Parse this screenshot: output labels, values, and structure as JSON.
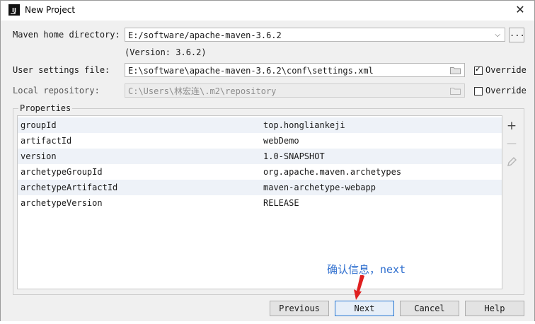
{
  "window": {
    "title": "New Project",
    "app_icon": "IJ"
  },
  "form": {
    "maven_home": {
      "label": "Maven home directory:",
      "value": "E:/software/apache-maven-3.6.2",
      "browse_label": "..."
    },
    "version_hint": "(Version: 3.6.2)",
    "user_settings": {
      "label": "User settings file:",
      "value": "E:\\software\\apache-maven-3.6.2\\conf\\settings.xml",
      "override_label": "Override",
      "override_checked": true
    },
    "local_repo": {
      "label": "Local repository:",
      "value": "C:\\Users\\林宏连\\.m2\\repository",
      "override_label": "Override",
      "override_checked": false
    }
  },
  "properties": {
    "title": "Properties",
    "rows": [
      {
        "key": "groupId",
        "value": "top.hongliankeji"
      },
      {
        "key": "artifactId",
        "value": "webDemo"
      },
      {
        "key": "version",
        "value": "1.0-SNAPSHOT"
      },
      {
        "key": "archetypeGroupId",
        "value": "org.apache.maven.archetypes"
      },
      {
        "key": "archetypeArtifactId",
        "value": "maven-archetype-webapp"
      },
      {
        "key": "archetypeVersion",
        "value": "RELEASE"
      }
    ],
    "icons": [
      "plus-icon",
      "minus-icon",
      "edit-icon"
    ]
  },
  "annotation": {
    "text": "确认信息，next",
    "color": "#2f6fcf",
    "arrow_color": "#e02020"
  },
  "buttons": {
    "previous": "Previous",
    "next": "Next",
    "cancel": "Cancel",
    "help": "Help"
  },
  "colors": {
    "primary_button_border": "#2a78d1",
    "row_stripe": "#eef2f8"
  }
}
